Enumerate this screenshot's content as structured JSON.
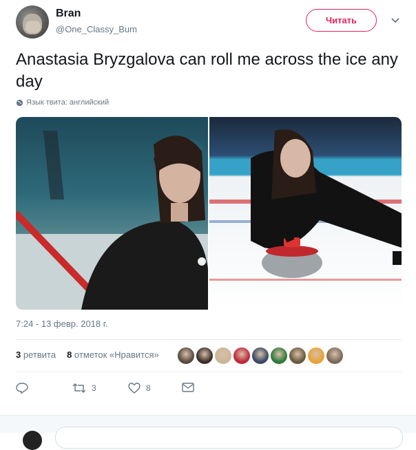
{
  "tweet": {
    "display_name": "Bran",
    "handle": "@One_Classy_Bum",
    "follow_label": "Читать",
    "text": "Anastasia Bryzgalova can roll me across the ice any day",
    "language_note": "Язык твита: английский",
    "timestamp": "7:24 - 13 февр. 2018 г."
  },
  "stats": {
    "retweets_count": "3",
    "retweets_label": "ретвита",
    "likes_count": "8",
    "likes_label": "отметок «Нравится»"
  },
  "likers": [
    {
      "color": "#5b4a42"
    },
    {
      "color": "#3b2f2b"
    },
    {
      "color": "#c9b79a"
    },
    {
      "color": "#c0283c"
    },
    {
      "color": "#3a4a66"
    },
    {
      "color": "#2f7a3a"
    },
    {
      "color": "#6a5a3c"
    },
    {
      "color": "#e8a23a"
    },
    {
      "color": "#7a6a5a"
    }
  ],
  "actions": {
    "reply": {
      "icon": "reply-icon",
      "count": ""
    },
    "retweet": {
      "icon": "retweet-icon",
      "count": "3"
    },
    "like": {
      "icon": "heart-icon",
      "count": "8"
    },
    "message": {
      "icon": "envelope-icon",
      "count": ""
    }
  },
  "colors": {
    "accent": "#e0245e",
    "secondary_text": "#657786",
    "divider": "#e6ecf0"
  }
}
